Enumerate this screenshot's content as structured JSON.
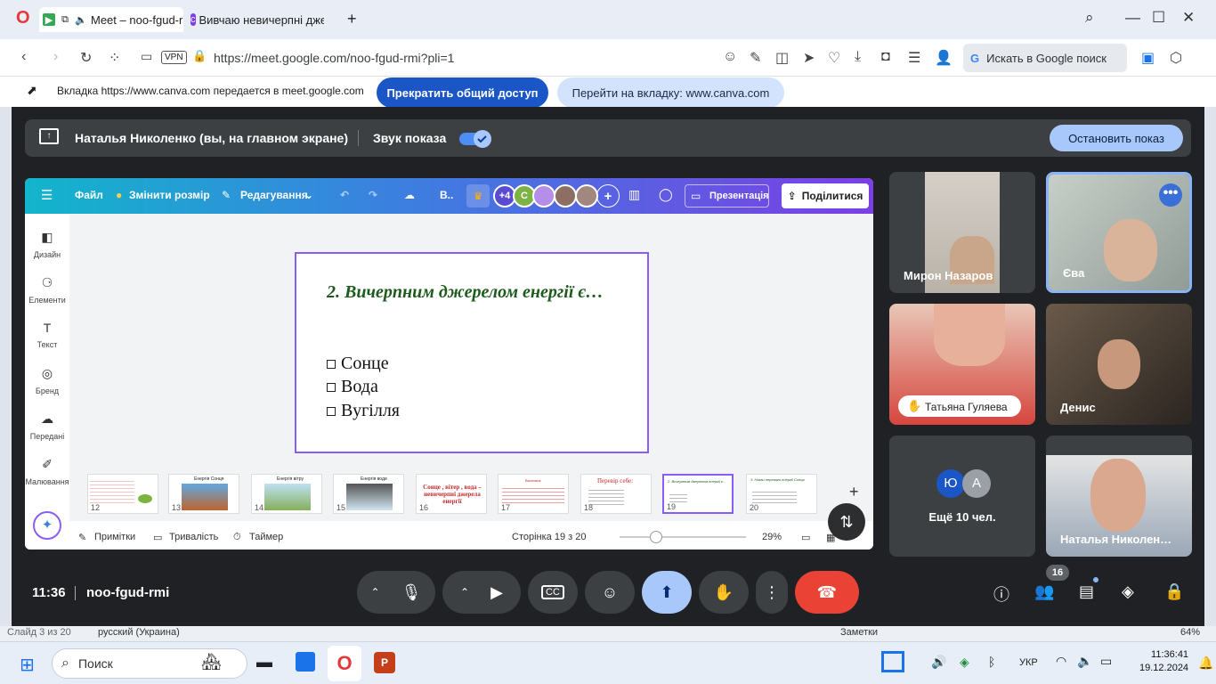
{
  "browser": {
    "tabs": [
      {
        "label": "Meet – noo-fgud-r"
      },
      {
        "label": "Вивчаю невичерпні дже"
      }
    ],
    "url": "https://meet.google.com/noo-fgud-rmi?pli=1",
    "vpn_label": "VPN",
    "google_search": "Искать в Google поиск"
  },
  "share_banner": {
    "message": "Вкладка https://www.canva.com передается в meet.google.com",
    "stop_label": "Прекратить общий доступ",
    "goto_label": "Перейти на вкладку: www.canva.com"
  },
  "presenting_bar": {
    "presenter": "Наталья Николенко (вы, на главном экране)",
    "sound_label": "Звук показа",
    "sound_on": true,
    "stop_label": "Остановить показ"
  },
  "canva": {
    "menu": {
      "file": "Файл",
      "resize": "Змінити розмір",
      "edit": "Редагування",
      "more": "В..",
      "avatars_extra": "+4",
      "avatar_initial": "C",
      "present": "Презентація",
      "share": "Поділитися"
    },
    "side_items": [
      {
        "label": "Дизайн"
      },
      {
        "label": "Елементи"
      },
      {
        "label": "Текст"
      },
      {
        "label": "Бренд"
      },
      {
        "label": "Передані"
      },
      {
        "label": "Малювання"
      }
    ],
    "slide": {
      "title": "2. Вичерпним джерелом енергії є…",
      "options": [
        "Сонце",
        "Вода",
        "Вугілля"
      ]
    },
    "thumbnails": [
      {
        "num": "12",
        "text": ""
      },
      {
        "num": "13",
        "text": "Енергія Сонця"
      },
      {
        "num": "14",
        "text": "Енергія вітру"
      },
      {
        "num": "15",
        "text": "Енергія води"
      },
      {
        "num": "16",
        "text": "Сонце , вітер , вода – невичерпні джерела енергії"
      },
      {
        "num": "17",
        "text": "Висновок"
      },
      {
        "num": "18",
        "text": "Перевір себе:"
      },
      {
        "num": "19",
        "text": "2. Вичерпним джерелом енергії є…"
      },
      {
        "num": "20",
        "text": "3. Назви переваги енергії Сонця"
      }
    ],
    "footer": {
      "notes": "Примітки",
      "duration": "Тривалість",
      "timer": "Таймер",
      "page": "Сторінка 19 з 20",
      "zoom": "29%"
    }
  },
  "participants": [
    {
      "name": "Мирон Назаров"
    },
    {
      "name": "Єва"
    },
    {
      "name": "Татьяна Гуляева"
    },
    {
      "name": "Денис"
    },
    {
      "name": "Ещё 10 чел.",
      "initials": [
        "Ю",
        "А"
      ]
    },
    {
      "name": "Наталья Николен…"
    }
  ],
  "meet_toolbar": {
    "time": "11:36",
    "meeting_code": "noo-fgud-rmi",
    "participant_count": "16"
  },
  "behind_window": {
    "slide_status": "Слайд 3 из 20",
    "language": "русский (Украина)",
    "notes": "Заметки",
    "zoom": "64%"
  },
  "taskbar": {
    "search": "Поиск",
    "lang": "УКР",
    "time": "11:36:41",
    "date": "19.12.2024"
  },
  "colors": {
    "meet_bg": "#202124",
    "end_call": "#ea4335",
    "accent_blue": "#1a56c6",
    "canva_purple": "#7b3fe4",
    "canva_teal": "#12b5cb"
  }
}
